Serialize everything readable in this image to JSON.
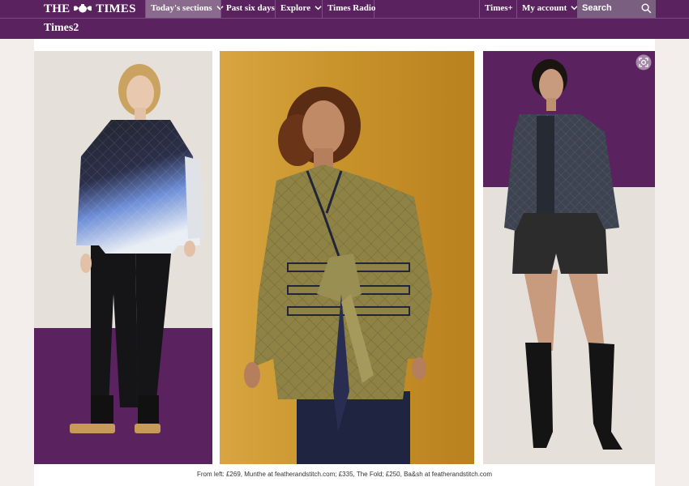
{
  "header": {
    "logo_left": "THE",
    "logo_right": "TIMES",
    "nav": [
      {
        "label": "Today's sections",
        "active": true
      },
      {
        "label": "Past six days"
      },
      {
        "label": "Explore"
      },
      {
        "label": "Times Radio"
      }
    ],
    "right_nav": [
      {
        "label": "Times+"
      },
      {
        "label": "My account"
      }
    ],
    "search_placeholder": "Search"
  },
  "section": {
    "title": "Times2"
  },
  "gallery": {
    "caption": "From left: £269, Munthe at featherandstitch.com; £335, The Fold; £250, Ba&sh at featherandstitch.com"
  },
  "colors": {
    "brand_purple": "#5a2360",
    "active_tab": "#8a6b8e",
    "mustard": "#c9962a"
  }
}
